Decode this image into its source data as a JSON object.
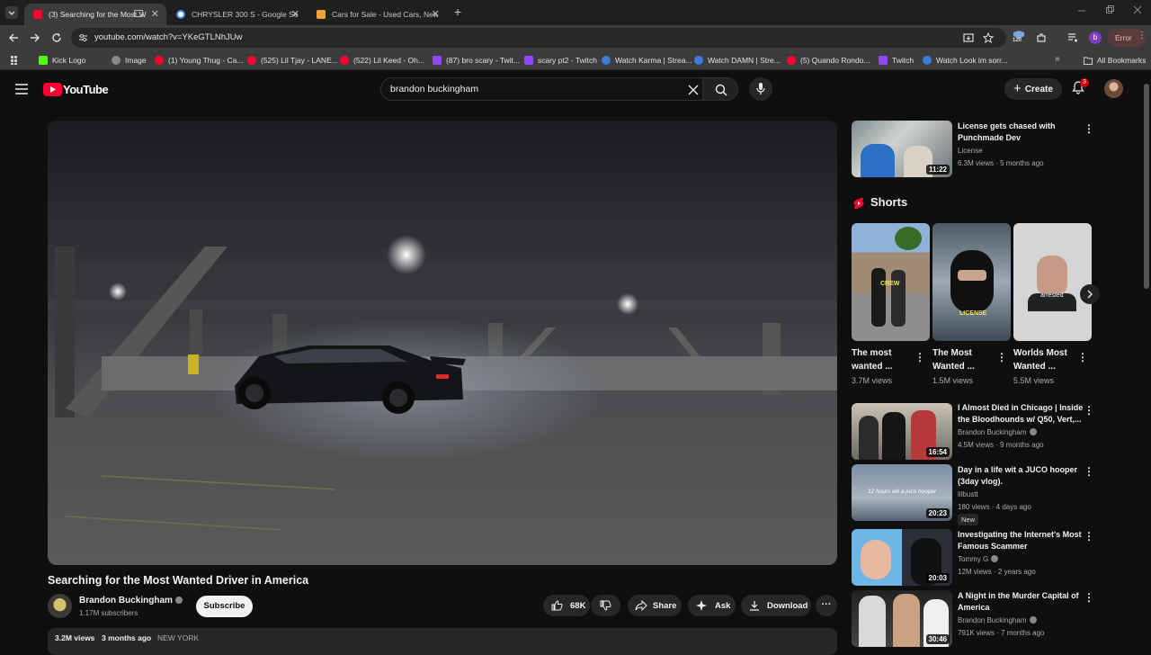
{
  "browser": {
    "tabs": [
      {
        "label": "(3) Searching for the Most W",
        "active": true
      },
      {
        "label": "CHRYSLER 300 S - Google Sear",
        "active": false
      },
      {
        "label": "Cars for Sale - Used Cars, New",
        "active": false
      }
    ],
    "url": "youtube.com/watch?v=YKeGTLNhJUw",
    "extension_badge": "120",
    "profile_letter": "b",
    "error_label": "Error",
    "bookmarks": [
      "Kick Logo",
      "Image",
      "(1) Young Thug - Ca...",
      "(525) Lil Tjay - LANE...",
      "(522) Lil Keed - Oh...",
      "(87) bro scary - Twit...",
      "scary pt2 - Twitch",
      "Watch Karma | Strea...",
      "Watch DAMN | Stre...",
      "(5) Quando Rondo...",
      "Twitch",
      "Watch Look im sorr..."
    ],
    "all_bookmarks": "All Bookmarks",
    "more_bookmarks": "»"
  },
  "youtube": {
    "logo_text": "YouTube",
    "search_value": "brandon buckingham",
    "create_label": "Create",
    "notification_count": "3"
  },
  "video": {
    "title": "Searching for the Most Wanted Driver in America",
    "channel": "Brandon Buckingham",
    "subscribers": "1.17M subscribers",
    "subscribe_label": "Subscribe",
    "likes": "68K",
    "share_label": "Share",
    "ask_label": "Ask",
    "download_label": "Download",
    "views": "3.2M views",
    "age": "3 months ago",
    "location": "NEW YORK"
  },
  "shorts": {
    "heading": "Shorts",
    "items": [
      {
        "title": "The most wanted ...",
        "views": "3.7M views",
        "overlay": "CREW"
      },
      {
        "title": "The Most Wanted ...",
        "views": "1.5M views",
        "overlay": "LICENSE"
      },
      {
        "title": "Worlds Most Wanted ...",
        "views": "5.5M views",
        "overlay": "arrested"
      }
    ]
  },
  "related": [
    {
      "title": "License gets chased with Punchmade Dev",
      "channel": "License",
      "meta": "6.3M views · 5 months ago",
      "duration": "11:22",
      "verified": false,
      "badge": ""
    },
    {
      "title": "I Almost Died in Chicago | Inside the Bloodhounds w/ Q50, Vert,...",
      "channel": "Brandon Buckingham",
      "meta": "4.5M views · 9 months ago",
      "duration": "16:54",
      "verified": true,
      "badge": ""
    },
    {
      "title": "Day in a life wit a JUCO hooper (3day vlog).",
      "channel": "lilbustt",
      "meta": "180 views · 4 days ago",
      "duration": "20:23",
      "verified": false,
      "badge": "New",
      "thumb_text": "12 hours wit a juco hooper"
    },
    {
      "title": "Investigating the Internet's Most Famous Scammer",
      "channel": "Tommy G",
      "meta": "12M views · 2 years ago",
      "duration": "20:03",
      "verified": true,
      "badge": ""
    },
    {
      "title": "A Night in the Murder Capital of America",
      "channel": "Brandon Buckingham",
      "meta": "791K views · 7 months ago",
      "duration": "30:46",
      "verified": true,
      "badge": ""
    }
  ],
  "colors": {
    "youtube_red": "#ff0033",
    "background": "#0f0f0f",
    "chip": "#272727",
    "tab_active": "#3c3c3c"
  }
}
